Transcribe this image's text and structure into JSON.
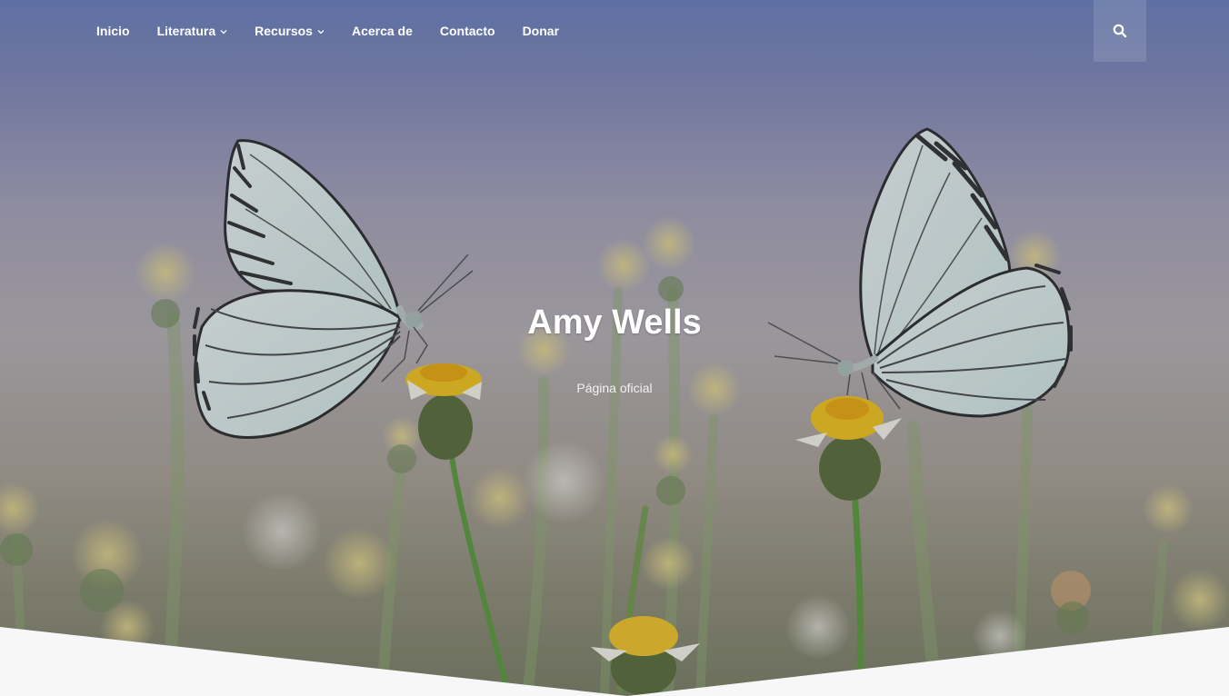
{
  "nav": {
    "items": [
      {
        "label": "Inicio",
        "has_dropdown": false
      },
      {
        "label": "Literatura",
        "has_dropdown": true
      },
      {
        "label": "Recursos",
        "has_dropdown": true
      },
      {
        "label": "Acerca de",
        "has_dropdown": false
      },
      {
        "label": "Contacto",
        "has_dropdown": false
      },
      {
        "label": "Donar",
        "has_dropdown": false
      }
    ],
    "search_icon": "search-icon"
  },
  "hero": {
    "title": "Amy Wells",
    "subtitle": "Página oficial",
    "background": "butterflies-on-flowers-photo"
  },
  "colors": {
    "nav_text": "#ffffff",
    "page_background": "#f7f7f7",
    "sky_top": "#6a7fba"
  }
}
